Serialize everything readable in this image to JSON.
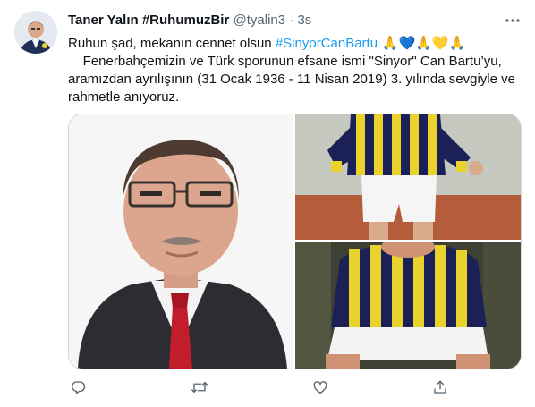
{
  "tweet": {
    "display_name": "Taner Yalın #RuhumuzBir",
    "handle": "@tyalin3",
    "separator": "·",
    "time": "3s",
    "line1_text": "Ruhun şad, mekanın cennet olsun ",
    "line1_hashtag": "#SinyorCanBartu",
    "line1_emoji": " 🙏💙🙏💛🙏",
    "body": "    Fenerbahçemizin ve Türk sporunun efsane ismi \"Sinyor\" Can Bartu’yu, aramızdan ayrılışının (31 Ocak 1936 - 11 Nisan 2019) 3. yılında sevgiyle ve rahmetle anıyoruz."
  },
  "icons": {
    "more": "more-horizontal-icon",
    "reply": "reply-icon",
    "retweet": "retweet-icon",
    "like": "like-icon",
    "share": "share-icon"
  },
  "colors": {
    "accent": "#1d9bf0",
    "secondary_text": "#536471",
    "border": "#cfd9de",
    "fenerbahce_yellow": "#e9d22c",
    "fenerbahce_navy": "#1b2157"
  }
}
